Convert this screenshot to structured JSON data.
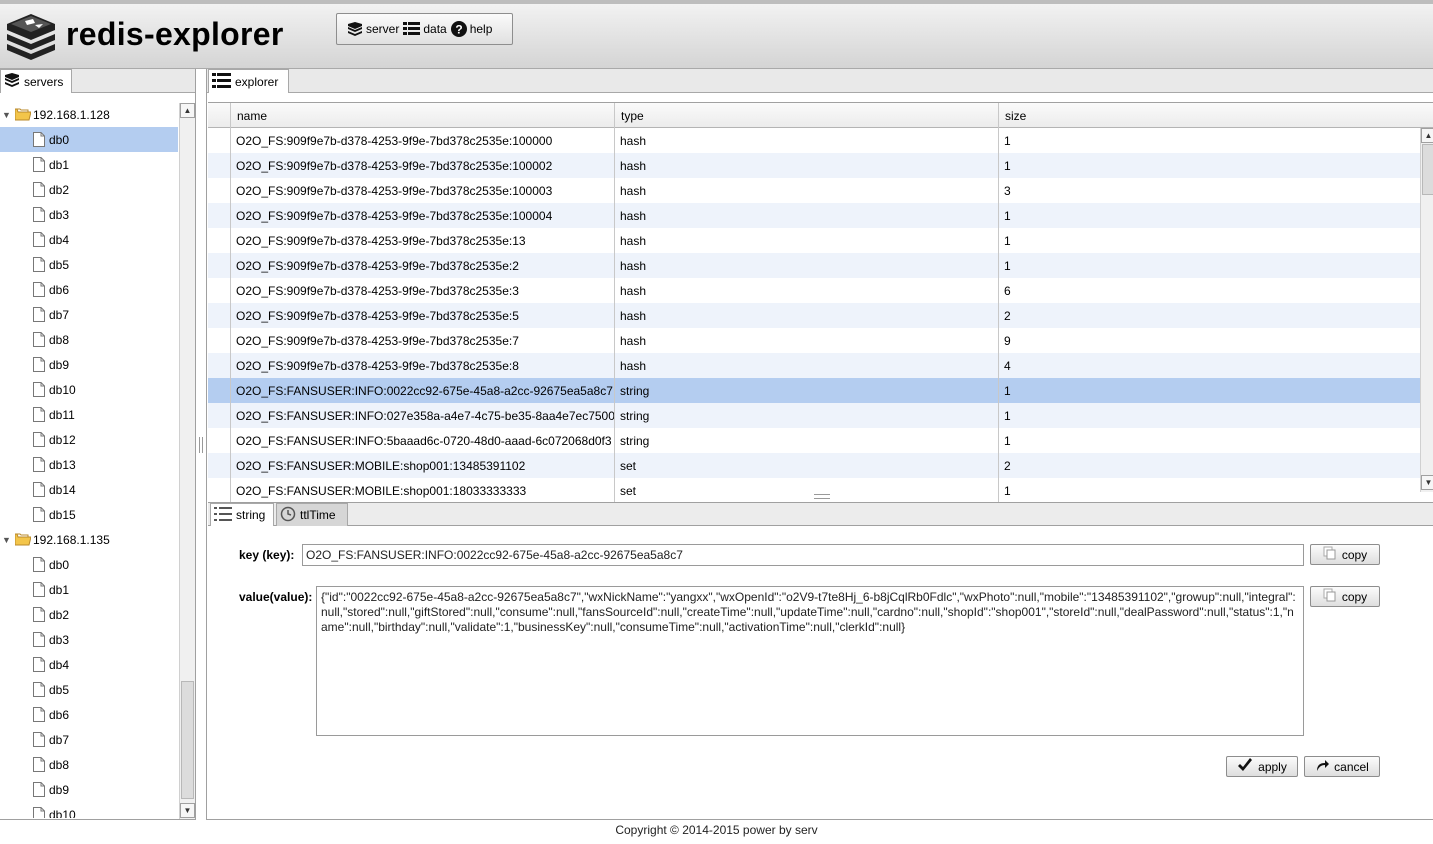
{
  "app": {
    "title": "redis-explorer",
    "logo_icon": "redis-stack-icon"
  },
  "menu": {
    "server_label": "server",
    "data_label": "data",
    "help_label": "help"
  },
  "left_tab": {
    "label": "servers"
  },
  "servers": [
    {
      "host": "192.168.1.128",
      "expanded": true,
      "dbs": [
        "db0",
        "db1",
        "db2",
        "db3",
        "db4",
        "db5",
        "db6",
        "db7",
        "db8",
        "db9",
        "db10",
        "db11",
        "db12",
        "db13",
        "db14",
        "db15"
      ],
      "selected_db": "db0"
    },
    {
      "host": "192.168.1.135",
      "expanded": true,
      "dbs": [
        "db0",
        "db1",
        "db2",
        "db3",
        "db4",
        "db5",
        "db6",
        "db7",
        "db8",
        "db9",
        "db10"
      ]
    }
  ],
  "right_tab": {
    "label": "explorer"
  },
  "grid": {
    "columns": [
      "name",
      "type",
      "size"
    ],
    "rows": [
      {
        "name": "O2O_FS:909f9e7b-d378-4253-9f9e-7bd378c2535e:100000",
        "type": "hash",
        "size": "1"
      },
      {
        "name": "O2O_FS:909f9e7b-d378-4253-9f9e-7bd378c2535e:100002",
        "type": "hash",
        "size": "1"
      },
      {
        "name": "O2O_FS:909f9e7b-d378-4253-9f9e-7bd378c2535e:100003",
        "type": "hash",
        "size": "3"
      },
      {
        "name": "O2O_FS:909f9e7b-d378-4253-9f9e-7bd378c2535e:100004",
        "type": "hash",
        "size": "1"
      },
      {
        "name": "O2O_FS:909f9e7b-d378-4253-9f9e-7bd378c2535e:13",
        "type": "hash",
        "size": "1"
      },
      {
        "name": "O2O_FS:909f9e7b-d378-4253-9f9e-7bd378c2535e:2",
        "type": "hash",
        "size": "1"
      },
      {
        "name": "O2O_FS:909f9e7b-d378-4253-9f9e-7bd378c2535e:3",
        "type": "hash",
        "size": "6"
      },
      {
        "name": "O2O_FS:909f9e7b-d378-4253-9f9e-7bd378c2535e:5",
        "type": "hash",
        "size": "2"
      },
      {
        "name": "O2O_FS:909f9e7b-d378-4253-9f9e-7bd378c2535e:7",
        "type": "hash",
        "size": "9"
      },
      {
        "name": "O2O_FS:909f9e7b-d378-4253-9f9e-7bd378c2535e:8",
        "type": "hash",
        "size": "4"
      },
      {
        "name": "O2O_FS:FANSUSER:INFO:0022cc92-675e-45a8-a2cc-92675ea5a8c7",
        "type": "string",
        "size": "1",
        "selected": true
      },
      {
        "name": "O2O_FS:FANSUSER:INFO:027e358a-a4e7-4c75-be35-8aa4e7ec7500",
        "type": "string",
        "size": "1"
      },
      {
        "name": "O2O_FS:FANSUSER:INFO:5baaad6c-0720-48d0-aaad-6c072068d0f3",
        "type": "string",
        "size": "1"
      },
      {
        "name": "O2O_FS:FANSUSER:MOBILE:shop001:13485391102",
        "type": "set",
        "size": "2"
      },
      {
        "name": "O2O_FS:FANSUSER:MOBILE:shop001:18033333333",
        "type": "set",
        "size": "1"
      }
    ]
  },
  "detail": {
    "tab_string": "string",
    "tab_ttl": "ttlTime",
    "key_label": "key  (key):",
    "key_value": "O2O_FS:FANSUSER:INFO:0022cc92-675e-45a8-a2cc-92675ea5a8c7",
    "value_label": "value(value):",
    "value_text": "{\"id\":\"0022cc92-675e-45a8-a2cc-92675ea5a8c7\",\"wxNickName\":\"yangxx\",\"wxOpenId\":\"o2V9-t7te8Hj_6-b8jCqlRb0Fdlc\",\"wxPhoto\":null,\"mobile\":\"13485391102\",\"growup\":null,\"integral\":null,\"stored\":null,\"giftStored\":null,\"consume\":null,\"fansSourceId\":null,\"createTime\":null,\"updateTime\":null,\"cardno\":null,\"shopId\":\"shop001\",\"storeId\":null,\"dealPassword\":null,\"status\":1,\"name\":null,\"birthday\":null,\"validate\":1,\"businessKey\":null,\"consumeTime\":null,\"activationTime\":null,\"clerkId\":null}",
    "copy_label": "copy",
    "apply_label": "apply",
    "cancel_label": "cancel"
  },
  "footer": {
    "text": "Copyright © 2014-2015 power by serv"
  },
  "colors": {
    "selection": "#b4cdf0",
    "alt_row": "#eef3fb",
    "header_bg": "#dcdcdc"
  }
}
